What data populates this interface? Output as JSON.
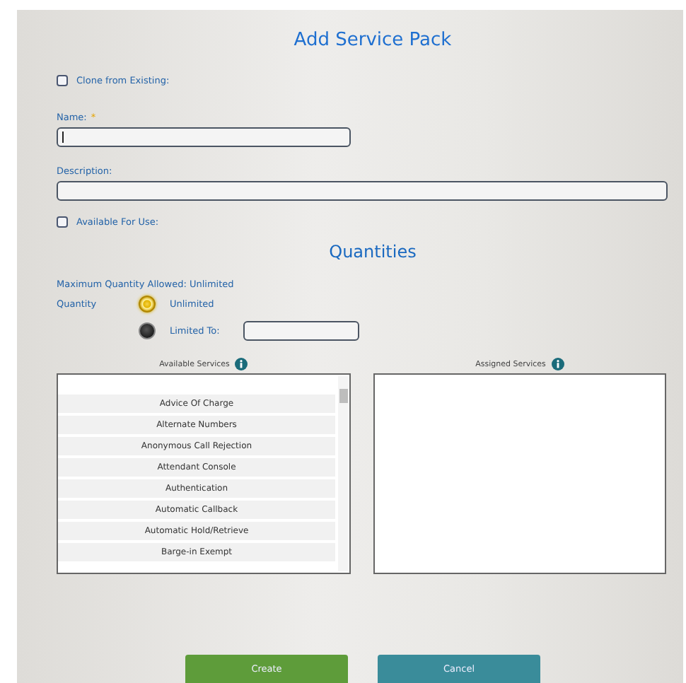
{
  "title": "Add Service Pack",
  "clone": {
    "label": "Clone from Existing:",
    "checked": false
  },
  "name": {
    "label": "Name:",
    "required_mark": "*"
  },
  "description": {
    "label": "Description:"
  },
  "available": {
    "label": "Available For Use:",
    "checked": false
  },
  "quantities": {
    "title": "Quantities",
    "max_text": "Maximum Quantity Allowed: Unlimited",
    "label": "Quantity",
    "options": [
      {
        "label": "Unlimited",
        "selected": true,
        "kind": "plain"
      },
      {
        "label": "Limited To:",
        "selected": false,
        "kind": "field"
      }
    ]
  },
  "available_services": {
    "label": "Available Services",
    "items": [
      "Advice Of Charge",
      "Alternate Numbers",
      "Anonymous Call Rejection",
      "Attendant Console",
      "Authentication",
      "Automatic Callback",
      "Automatic Hold/Retrieve",
      "Barge-in Exempt"
    ]
  },
  "assigned_services": {
    "label": "Assigned Services"
  },
  "buttons": [
    {
      "label": "Create",
      "kind": "primary"
    },
    {
      "label": "Cancel",
      "kind": "secondary"
    }
  ]
}
